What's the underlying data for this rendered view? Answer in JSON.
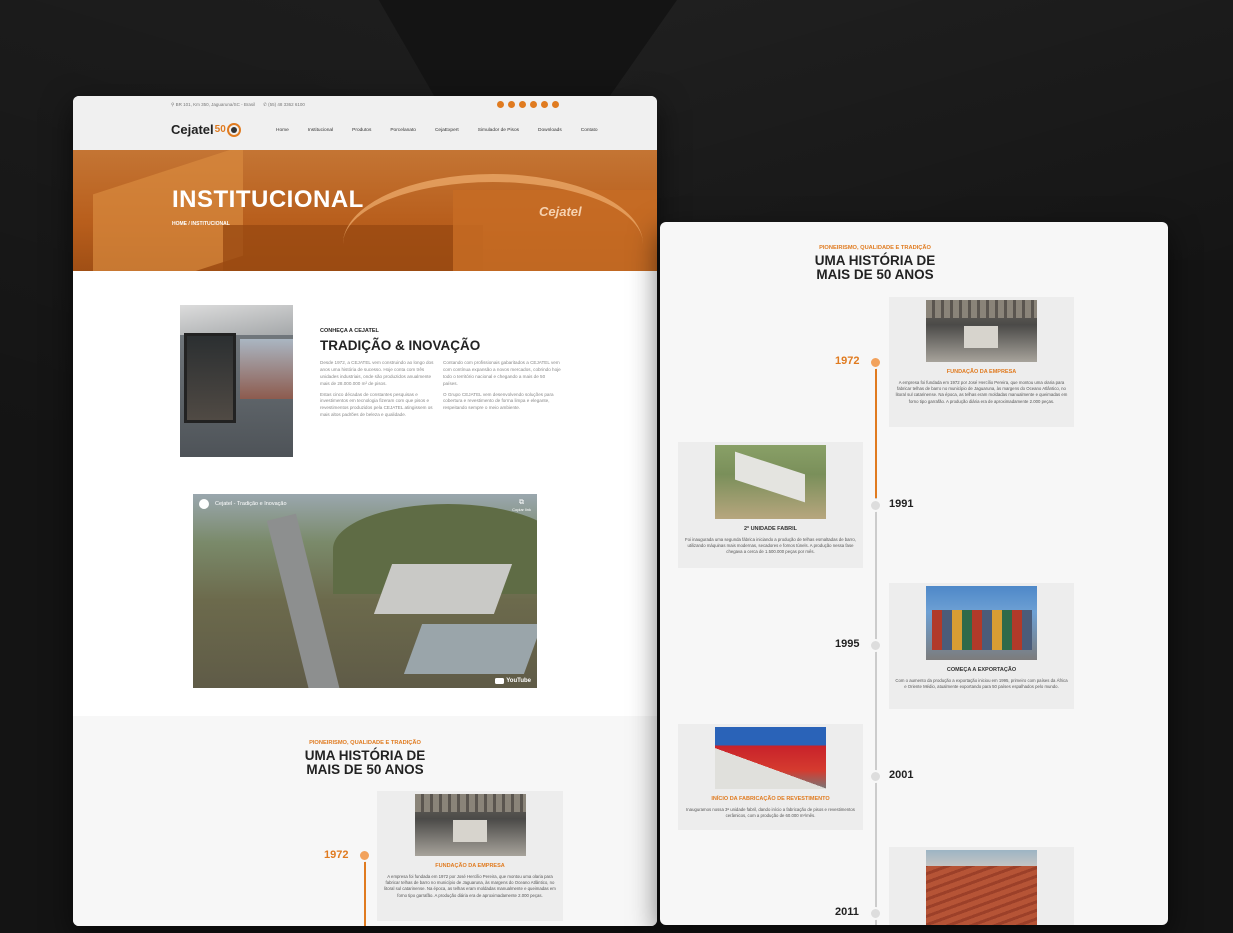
{
  "site": {
    "address": "BR 101, Km 350, Jaguaruna/SC - Brasil",
    "phone": "(55) 48 3362 6100",
    "logo": "Cejatel",
    "logo_badge": "50",
    "nav": [
      "Home",
      "Institucional",
      "Produtos",
      "Porcelanato",
      "CejaExpert",
      "Simulador de Pisos",
      "Downloads",
      "Contato"
    ],
    "social_icons": [
      "facebook-icon",
      "instagram-icon",
      "youtube-icon",
      "linkedin-icon",
      "pinterest-icon",
      "whatsapp-icon"
    ],
    "accent": "#e07b20"
  },
  "hero": {
    "title": "INSTITUCIONAL",
    "breadcrumb": "HOME / INSTITUCIONAL",
    "brand": "Cejatel"
  },
  "about": {
    "kicker": "CONHEÇA A CEJATEL",
    "title": "TRADIÇÃO & INOVAÇÃO",
    "col1": [
      "Desde 1972, a CEJATEL vem construindo ao longo dos anos uma história de sucesso. Hoje conta com três unidades industriais, onde são produzidos anualmente mais de 28.000.000 m² de pisos.",
      "Estas cinco décadas de constantes pesquisas e investimentos em tecnologia fizeram com que pisos e revestimentos produzidos pela CEJATEL atingissem os mais altos padrões de beleza e qualidade."
    ],
    "col2": [
      "Contando com profissionais gabaritados a CEJATEL vem com contínua expansão a novos mercados, cobrindo hoje todo o território nacional e chegando a mais de 50 países.",
      "O Grupo CEJATEL vem desenvolvendo soluções para cobertura e revestimento de forma limpa e elegante, respeitando sempre o meio ambiente."
    ]
  },
  "video": {
    "title": "Cejatel - Tradição e Inovação",
    "copy_label": "Copiar link",
    "platform": "YouTube"
  },
  "history": {
    "kicker": "PIONEIRISMO, QUALIDADE E TRADIÇÃO",
    "title_line1": "UMA HISTÓRIA DE",
    "title_line2": "MAIS DE 50 ANOS",
    "events": [
      {
        "year": "1972",
        "title": "FUNDAÇÃO DA EMPRESA",
        "desc": "A empresa foi fundada em 1972 por José Hercílio Pereira, que montou uma olaria para fabricar telhas de barro no município de Jaguaruna, às margens do Oceano Atlântico, no litoral sul catarinense. Na época, as telhas eram moldadas manualmente e queimadas em forno tipo garrafão. A produção diária era de aproximadamente 2.000 peças."
      },
      {
        "year": "1991",
        "title": "2ª UNIDADE FABRIL",
        "desc": "Foi inaugurada uma segunda fábrica iniciando a produção de telhas esmaltadas de barro, utilizando máquinas mais modernas, secadores e fornos túnels. A produção nessa fase chegava a cerca de 1.500.000 peças por mês."
      },
      {
        "year": "1995",
        "title": "COMEÇA A EXPORTAÇÃO",
        "desc": "Com o aumento da produção a exportação iniciou em 1995, primeiro com países da África e Oriente Médio, atualmente exportando para 50 países espalhados pelo mundo."
      },
      {
        "year": "2001",
        "title": "INÍCIO DA FABRICAÇÃO DE REVESTIMENTO",
        "desc": "Inauguramos nossa 3ª unidade fabril, dando início a fabricação de pisos e revestimentos cerâmicos, com a produção de 60.000 m²/mês."
      },
      {
        "year": "2011",
        "title": "",
        "desc": ""
      }
    ]
  }
}
